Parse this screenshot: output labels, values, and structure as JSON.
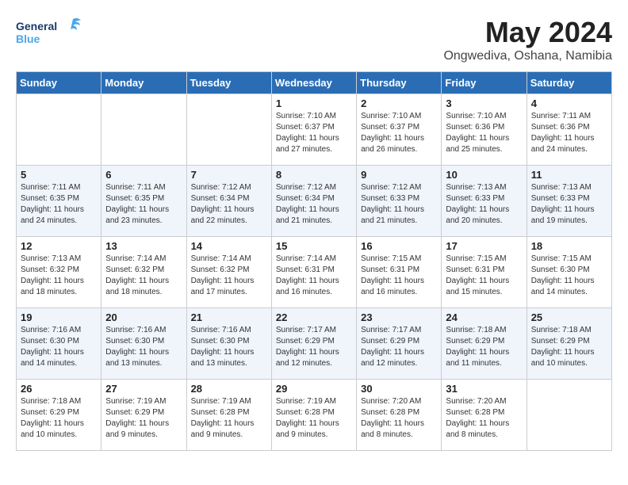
{
  "header": {
    "logo_general": "General",
    "logo_blue": "Blue",
    "month_year": "May 2024",
    "location": "Ongwediva, Oshana, Namibia"
  },
  "days_of_week": [
    "Sunday",
    "Monday",
    "Tuesday",
    "Wednesday",
    "Thursday",
    "Friday",
    "Saturday"
  ],
  "weeks": [
    {
      "row_class": "row-white",
      "days": [
        {
          "num": "",
          "info": ""
        },
        {
          "num": "",
          "info": ""
        },
        {
          "num": "",
          "info": ""
        },
        {
          "num": "1",
          "info": "Sunrise: 7:10 AM\nSunset: 6:37 PM\nDaylight: 11 hours\nand 27 minutes."
        },
        {
          "num": "2",
          "info": "Sunrise: 7:10 AM\nSunset: 6:37 PM\nDaylight: 11 hours\nand 26 minutes."
        },
        {
          "num": "3",
          "info": "Sunrise: 7:10 AM\nSunset: 6:36 PM\nDaylight: 11 hours\nand 25 minutes."
        },
        {
          "num": "4",
          "info": "Sunrise: 7:11 AM\nSunset: 6:36 PM\nDaylight: 11 hours\nand 24 minutes."
        }
      ]
    },
    {
      "row_class": "row-alt",
      "days": [
        {
          "num": "5",
          "info": "Sunrise: 7:11 AM\nSunset: 6:35 PM\nDaylight: 11 hours\nand 24 minutes."
        },
        {
          "num": "6",
          "info": "Sunrise: 7:11 AM\nSunset: 6:35 PM\nDaylight: 11 hours\nand 23 minutes."
        },
        {
          "num": "7",
          "info": "Sunrise: 7:12 AM\nSunset: 6:34 PM\nDaylight: 11 hours\nand 22 minutes."
        },
        {
          "num": "8",
          "info": "Sunrise: 7:12 AM\nSunset: 6:34 PM\nDaylight: 11 hours\nand 21 minutes."
        },
        {
          "num": "9",
          "info": "Sunrise: 7:12 AM\nSunset: 6:33 PM\nDaylight: 11 hours\nand 21 minutes."
        },
        {
          "num": "10",
          "info": "Sunrise: 7:13 AM\nSunset: 6:33 PM\nDaylight: 11 hours\nand 20 minutes."
        },
        {
          "num": "11",
          "info": "Sunrise: 7:13 AM\nSunset: 6:33 PM\nDaylight: 11 hours\nand 19 minutes."
        }
      ]
    },
    {
      "row_class": "row-white",
      "days": [
        {
          "num": "12",
          "info": "Sunrise: 7:13 AM\nSunset: 6:32 PM\nDaylight: 11 hours\nand 18 minutes."
        },
        {
          "num": "13",
          "info": "Sunrise: 7:14 AM\nSunset: 6:32 PM\nDaylight: 11 hours\nand 18 minutes."
        },
        {
          "num": "14",
          "info": "Sunrise: 7:14 AM\nSunset: 6:32 PM\nDaylight: 11 hours\nand 17 minutes."
        },
        {
          "num": "15",
          "info": "Sunrise: 7:14 AM\nSunset: 6:31 PM\nDaylight: 11 hours\nand 16 minutes."
        },
        {
          "num": "16",
          "info": "Sunrise: 7:15 AM\nSunset: 6:31 PM\nDaylight: 11 hours\nand 16 minutes."
        },
        {
          "num": "17",
          "info": "Sunrise: 7:15 AM\nSunset: 6:31 PM\nDaylight: 11 hours\nand 15 minutes."
        },
        {
          "num": "18",
          "info": "Sunrise: 7:15 AM\nSunset: 6:30 PM\nDaylight: 11 hours\nand 14 minutes."
        }
      ]
    },
    {
      "row_class": "row-alt",
      "days": [
        {
          "num": "19",
          "info": "Sunrise: 7:16 AM\nSunset: 6:30 PM\nDaylight: 11 hours\nand 14 minutes."
        },
        {
          "num": "20",
          "info": "Sunrise: 7:16 AM\nSunset: 6:30 PM\nDaylight: 11 hours\nand 13 minutes."
        },
        {
          "num": "21",
          "info": "Sunrise: 7:16 AM\nSunset: 6:30 PM\nDaylight: 11 hours\nand 13 minutes."
        },
        {
          "num": "22",
          "info": "Sunrise: 7:17 AM\nSunset: 6:29 PM\nDaylight: 11 hours\nand 12 minutes."
        },
        {
          "num": "23",
          "info": "Sunrise: 7:17 AM\nSunset: 6:29 PM\nDaylight: 11 hours\nand 12 minutes."
        },
        {
          "num": "24",
          "info": "Sunrise: 7:18 AM\nSunset: 6:29 PM\nDaylight: 11 hours\nand 11 minutes."
        },
        {
          "num": "25",
          "info": "Sunrise: 7:18 AM\nSunset: 6:29 PM\nDaylight: 11 hours\nand 10 minutes."
        }
      ]
    },
    {
      "row_class": "row-white",
      "days": [
        {
          "num": "26",
          "info": "Sunrise: 7:18 AM\nSunset: 6:29 PM\nDaylight: 11 hours\nand 10 minutes."
        },
        {
          "num": "27",
          "info": "Sunrise: 7:19 AM\nSunset: 6:29 PM\nDaylight: 11 hours\nand 9 minutes."
        },
        {
          "num": "28",
          "info": "Sunrise: 7:19 AM\nSunset: 6:28 PM\nDaylight: 11 hours\nand 9 minutes."
        },
        {
          "num": "29",
          "info": "Sunrise: 7:19 AM\nSunset: 6:28 PM\nDaylight: 11 hours\nand 9 minutes."
        },
        {
          "num": "30",
          "info": "Sunrise: 7:20 AM\nSunset: 6:28 PM\nDaylight: 11 hours\nand 8 minutes."
        },
        {
          "num": "31",
          "info": "Sunrise: 7:20 AM\nSunset: 6:28 PM\nDaylight: 11 hours\nand 8 minutes."
        },
        {
          "num": "",
          "info": ""
        }
      ]
    }
  ]
}
